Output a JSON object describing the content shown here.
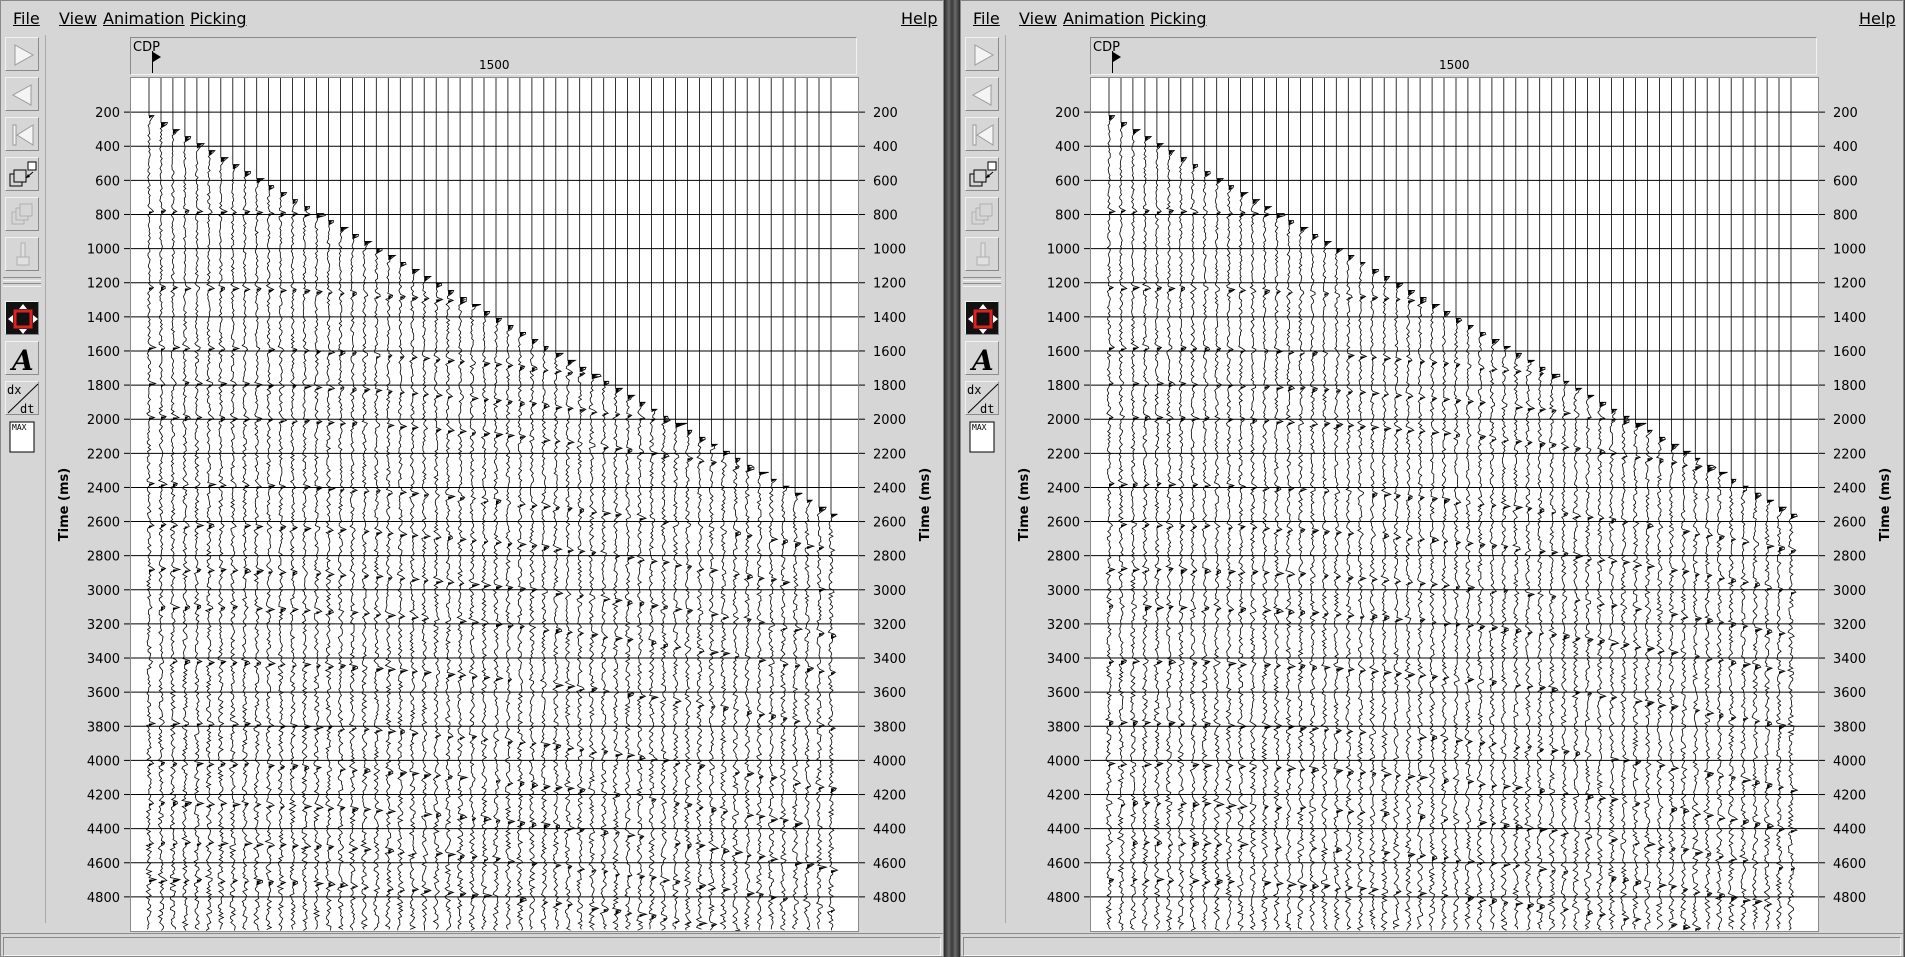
{
  "panes": [
    {
      "menu": {
        "file": "File",
        "view": "View",
        "animation": "Animation",
        "picking": "Picking",
        "help": "Help"
      },
      "header": {
        "label": "CDP",
        "value": "1500"
      },
      "axis_title": "Time (ms)",
      "status_text": "",
      "toolbar": [
        "play-forward-icon",
        "play-backward-icon",
        "rewind-to-start-icon",
        "zoom-window-icon",
        "stack-windows-icon",
        "paintbrush-icon",
        "pan-move-icon",
        "annotate-text-icon",
        "dx-dt-slope-icon",
        "max-amplitude-icon"
      ]
    },
    {
      "menu": {
        "file": "File",
        "view": "View",
        "animation": "Animation",
        "picking": "Picking",
        "help": "Help"
      },
      "header": {
        "label": "CDP",
        "value": "1500"
      },
      "axis_title": "Time (ms)",
      "status_text": "",
      "toolbar": [
        "play-forward-icon",
        "play-backward-icon",
        "rewind-to-start-icon",
        "zoom-window-icon",
        "stack-windows-icon",
        "paintbrush-icon",
        "pan-move-icon",
        "annotate-text-icon",
        "dx-dt-slope-icon",
        "max-amplitude-icon"
      ]
    }
  ],
  "chart_data": {
    "type": "wiggle-trace seismic gather",
    "y_axis": {
      "label": "Time (ms)",
      "ticks": [
        200,
        400,
        600,
        800,
        1000,
        1200,
        1400,
        1600,
        1800,
        2000,
        2200,
        2400,
        2600,
        2800,
        3000,
        3200,
        3400,
        3600,
        3800,
        4000,
        4200,
        4400,
        4600,
        4800
      ]
    },
    "x_axis": {
      "label": "CDP",
      "ticks": [
        1500
      ]
    },
    "ylim": [
      0,
      5000
    ]
  }
}
